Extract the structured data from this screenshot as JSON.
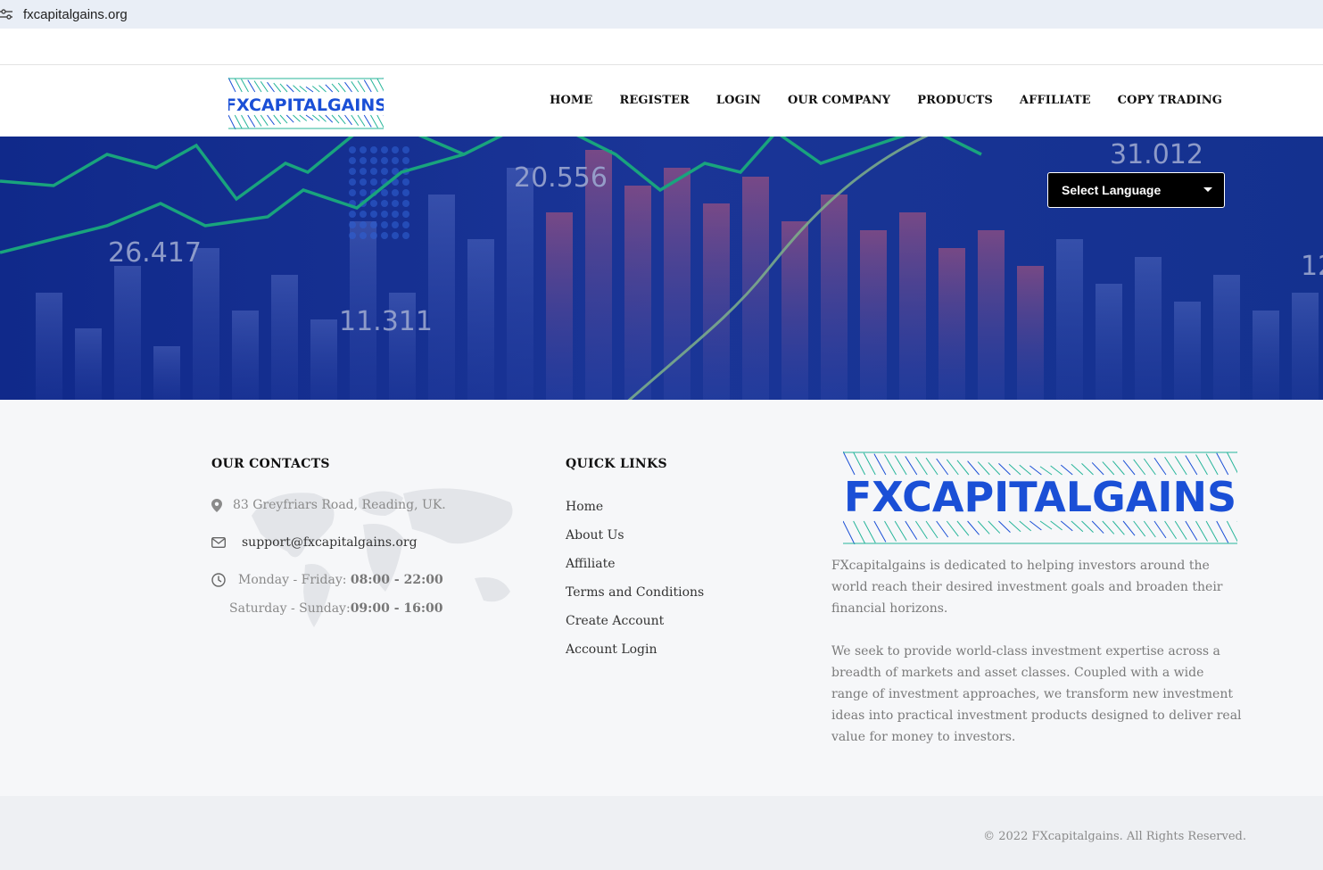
{
  "browser": {
    "url": "fxcapitalgains.org"
  },
  "brand": {
    "logo_text": "FXCAPITALGAINS",
    "accent": "#1a4fd6",
    "teal": "#27b59a"
  },
  "nav": {
    "items": [
      {
        "label": "HOME"
      },
      {
        "label": "REGISTER"
      },
      {
        "label": "LOGIN"
      },
      {
        "label": "OUR COMPANY"
      },
      {
        "label": "PRODUCTS"
      },
      {
        "label": "AFFILIATE"
      },
      {
        "label": "COPY TRADING"
      }
    ]
  },
  "hero": {
    "numbers": [
      "26.417",
      "20.556",
      "11.311",
      "31.012",
      "12"
    ],
    "language_select": "Select Language"
  },
  "contacts": {
    "title": "OUR CONTACTS",
    "address": "83 Greyfriars Road, Reading, UK.",
    "email": "support@fxcapitalgains.org",
    "weekday_label": "Monday - Friday: ",
    "weekday_hours": "08:00 - 22:00",
    "weekend_label": "Saturday - Sunday: ",
    "weekend_hours": "09:00 - 16:00"
  },
  "quick_links": {
    "title": "QUICK LINKS",
    "items": [
      "Home",
      "About Us",
      "Affiliate",
      "Terms and Conditions",
      "Create Account",
      "Account Login"
    ]
  },
  "about": {
    "p1": "FXcapitalgains is dedicated to helping investors around the world reach their desired investment goals and broaden their financial horizons.",
    "p2": "We seek to provide world-class investment expertise across a breadth of markets and asset classes. Coupled with a wide range of investment approaches, we transform new investment ideas into practical investment products designed to deliver real value for money to investors."
  },
  "footer": {
    "copyright": "© 2022 FXcapitalgains. All Rights Reserved."
  }
}
